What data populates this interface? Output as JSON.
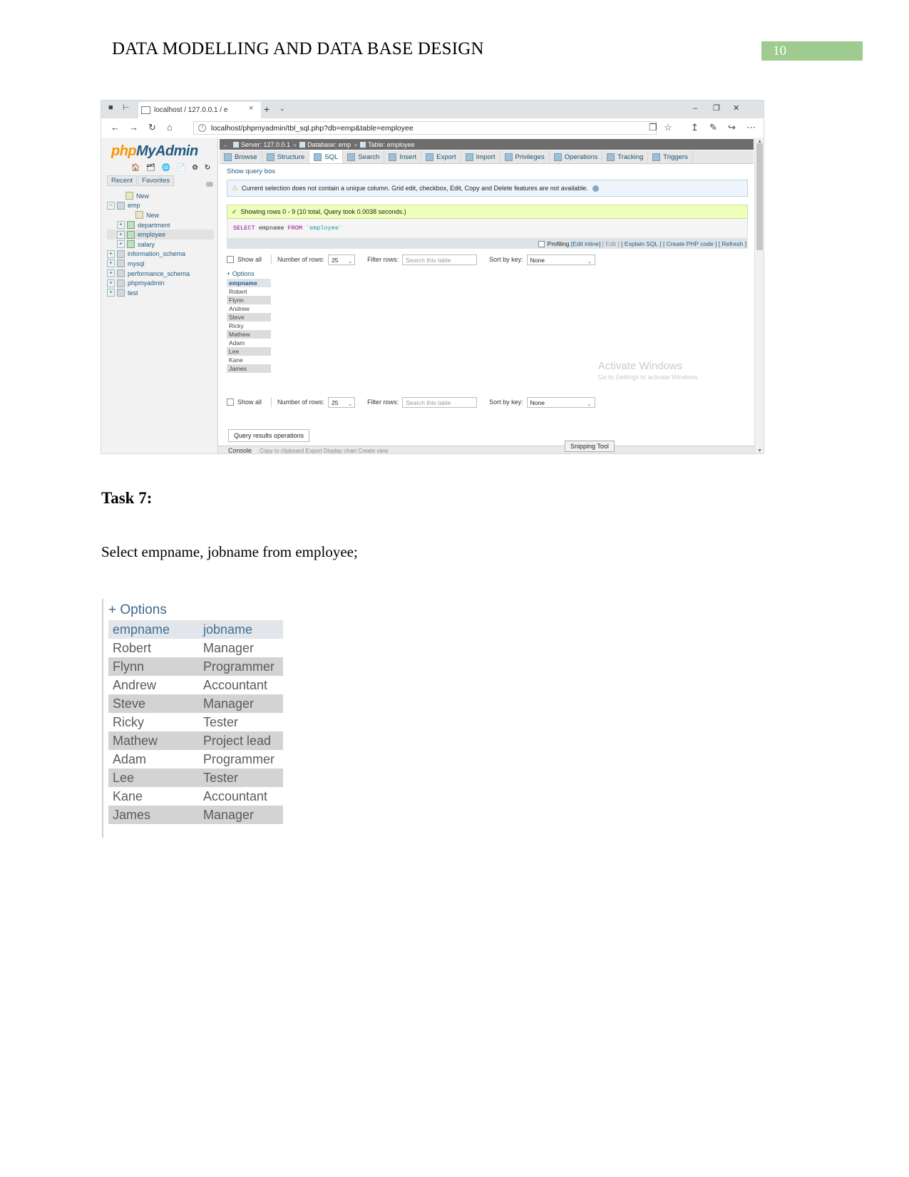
{
  "document": {
    "header_title": "DATA MODELLING AND DATA BASE DESIGN",
    "page_number": "10",
    "task_heading": "Task 7:",
    "task_query": "Select empname, jobname from employee;"
  },
  "browser": {
    "tab_title": "localhost / 127.0.0.1 / e",
    "tab_close": "×",
    "new_tab": "+",
    "tab_list_chevron": "⌄",
    "minimize": "–",
    "restore": "❐",
    "close": "✕",
    "back": "←",
    "forward": "→",
    "reload": "↻",
    "home": "⌂",
    "url": "localhost/phpmyadmin/tbl_sql.php?db=emp&table=employee",
    "reading_view": "❐",
    "favorite": "☆",
    "favorites_bar": "↥",
    "notes": "✎",
    "share": "↪",
    "settings_more": "⋯"
  },
  "phpmyadmin": {
    "logo_php": "php",
    "logo_myadmin": "MyAdmin",
    "logo_icons": "🏠 🗂 🌐 📄 ⚙ ↻",
    "recent": "Recent",
    "favorites": "Favorites",
    "tree": [
      {
        "label": "New",
        "indent": 1,
        "icon": "new-icon",
        "expander": "",
        "selected": false
      },
      {
        "label": "emp",
        "indent": 0,
        "icon": "db-icon",
        "expander": "−",
        "selected": false
      },
      {
        "label": "New",
        "indent": 2,
        "icon": "new-icon",
        "expander": "",
        "selected": false
      },
      {
        "label": "department",
        "indent": 1,
        "icon": "table-icon",
        "expander": "+",
        "selected": false
      },
      {
        "label": "employee",
        "indent": 1,
        "icon": "table-icon",
        "expander": "+",
        "selected": true
      },
      {
        "label": "salary",
        "indent": 1,
        "icon": "table-icon",
        "expander": "+",
        "selected": false
      },
      {
        "label": "information_schema",
        "indent": 0,
        "icon": "db-icon",
        "expander": "+",
        "selected": false
      },
      {
        "label": "mysql",
        "indent": 0,
        "icon": "db-icon",
        "expander": "+",
        "selected": false
      },
      {
        "label": "performance_schema",
        "indent": 0,
        "icon": "db-icon",
        "expander": "+",
        "selected": false
      },
      {
        "label": "phpmyadmin",
        "indent": 0,
        "icon": "db-icon",
        "expander": "+",
        "selected": false
      },
      {
        "label": "test",
        "indent": 0,
        "icon": "db-icon",
        "expander": "+",
        "selected": false
      }
    ],
    "breadcrumb": {
      "back_arrow": "←",
      "server": "Server: 127.0.0.1",
      "database": "Database: emp",
      "table": "Table: employee",
      "sep": "»",
      "gear": "⚙",
      "help": "❓"
    },
    "tabs": [
      {
        "label": "Browse",
        "active": false
      },
      {
        "label": "Structure",
        "active": false
      },
      {
        "label": "SQL",
        "active": true
      },
      {
        "label": "Search",
        "active": false
      },
      {
        "label": "Insert",
        "active": false
      },
      {
        "label": "Export",
        "active": false
      },
      {
        "label": "Import",
        "active": false
      },
      {
        "label": "Privileges",
        "active": false
      },
      {
        "label": "Operations",
        "active": false
      },
      {
        "label": "Tracking",
        "active": false
      },
      {
        "label": "Triggers",
        "active": false
      }
    ],
    "show_query_box": "Show query box",
    "warning": "Current selection does not contain a unique column. Grid edit, checkbox, Edit, Copy and Delete features are not available.",
    "success": "Showing rows 0 - 9 (10 total, Query took 0.0038 seconds.)",
    "sql": {
      "select": "SELECT",
      "column": "empname",
      "from": "FROM",
      "table": "`employee`"
    },
    "action_links": {
      "profiling": "Profiling",
      "edit_inline": "[Edit inline]",
      "edit": "[ Edit ]",
      "explain_sql": "[ Explain SQL ]",
      "create_php": "[ Create PHP code ]",
      "refresh": "[ Refresh ]"
    },
    "controls": {
      "show_all": "Show all",
      "number_of_rows_label": "Number of rows:",
      "number_of_rows_value": "25",
      "filter_rows_label": "Filter rows:",
      "filter_rows_placeholder": "Search this table",
      "sort_by_key_label": "Sort by key:",
      "sort_by_key_value": "None",
      "chevron": "⌄"
    },
    "options_link": "+ Options",
    "results_header": "empname",
    "results_rows": [
      "Robert",
      "Flynn",
      "Andrew",
      "Steve",
      "Ricky",
      "Mathew",
      "Adam",
      "Lee",
      "Kane",
      "James"
    ],
    "query_results_operations": "Query results operations",
    "console_label": "Console",
    "console_ops": "Copy to clipboard    Export    Display chart    Create view",
    "snipping_tool": "Snipping Tool",
    "watermark_title": "Activate Windows",
    "watermark_sub": "Go to Settings to activate Windows."
  },
  "result_table": {
    "options_link": "+ Options",
    "columns": [
      "empname",
      "jobname"
    ],
    "rows": [
      [
        "Robert",
        "Manager"
      ],
      [
        "Flynn",
        "Programmer"
      ],
      [
        "Andrew",
        "Accountant"
      ],
      [
        "Steve",
        "Manager"
      ],
      [
        "Ricky",
        "Tester"
      ],
      [
        "Mathew",
        "Project lead"
      ],
      [
        "Adam",
        "Programmer"
      ],
      [
        "Lee",
        "Tester"
      ],
      [
        "Kane",
        "Accountant"
      ],
      [
        "James",
        "Manager"
      ]
    ]
  },
  "colors": {
    "page_badge": "#9fcb8f",
    "success_bg": "#eeffbb",
    "warning_bg": "#eef4fb",
    "link": "#235a81",
    "logo_orange": "#f89406"
  }
}
